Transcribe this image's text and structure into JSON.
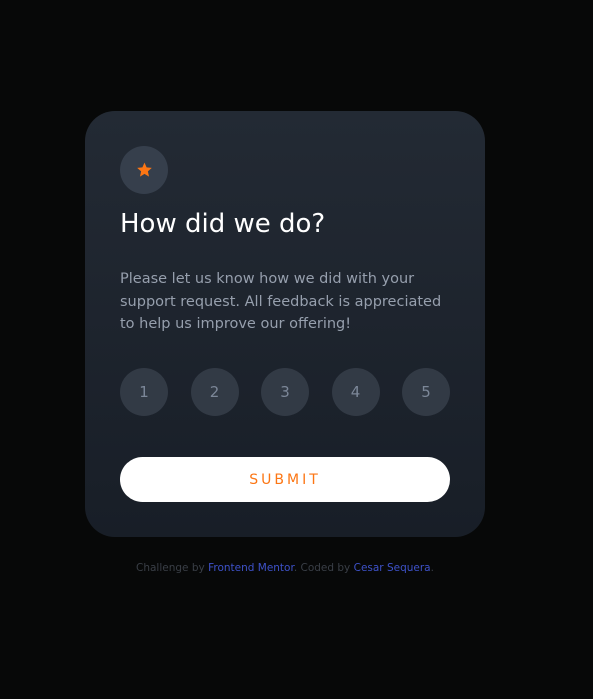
{
  "card": {
    "title": "How did we do?",
    "description": "Please let us know how we did with your support request. All feedback is appreciated to help us improve our offering!",
    "icon": "star-icon",
    "ratings": [
      "1",
      "2",
      "3",
      "4",
      "5"
    ],
    "submit_label": "SUBMIT"
  },
  "attribution": {
    "prefix": "Challenge by ",
    "link1": "Frontend Mentor",
    "middle": ". Coded by ",
    "link2": "Cesar Sequera",
    "suffix": "."
  },
  "colors": {
    "background": "#070808",
    "card_top": "#232a34",
    "card_bottom": "#181e27",
    "accent_orange": "#fc7614",
    "rating_bg": "#323a45",
    "link_blue": "#3e52c9"
  }
}
